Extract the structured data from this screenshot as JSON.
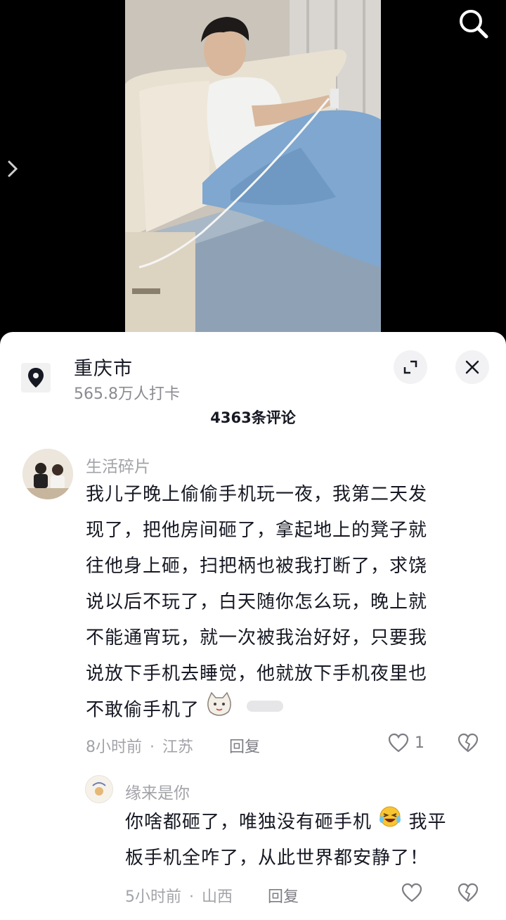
{
  "video": {
    "search_icon": "search-icon",
    "side_arrow_icon": "chevron-right-icon"
  },
  "location": {
    "city": "重庆市",
    "checkins": "565.8万人打卡",
    "pin_icon": "location-pin-icon",
    "expand_icon": "expand-icon",
    "close_icon": "close-icon"
  },
  "comments": {
    "title": "4363条评论",
    "items": [
      {
        "user": "生活碎片",
        "lines": [
          "我儿子晚上偷偷手机玩一夜，我第二天发",
          "现了，把他房间砸了，拿起地上的凳子就",
          "往他身上砸，扫把柄也被我打断了，求饶",
          "说以后不玩了，白天随你怎么玩，晚上就",
          "不能通宵玩，就一次被我治好好，只要我",
          "说放下手机去睡觉，他就放下手机夜里也",
          "不敢偷手机了"
        ],
        "time": "8小时前",
        "region": "江苏",
        "reply_label": "回复",
        "likes": "1"
      }
    ],
    "replies": [
      {
        "user": "缘来是你",
        "lines": [
          "你啥都砸了，唯独没有砸手机",
          "我平",
          "板手机全咋了，从此世界都安静了！"
        ],
        "time": "5小时前",
        "region": "山西",
        "reply_label": "回复"
      }
    ],
    "separator": "·"
  }
}
